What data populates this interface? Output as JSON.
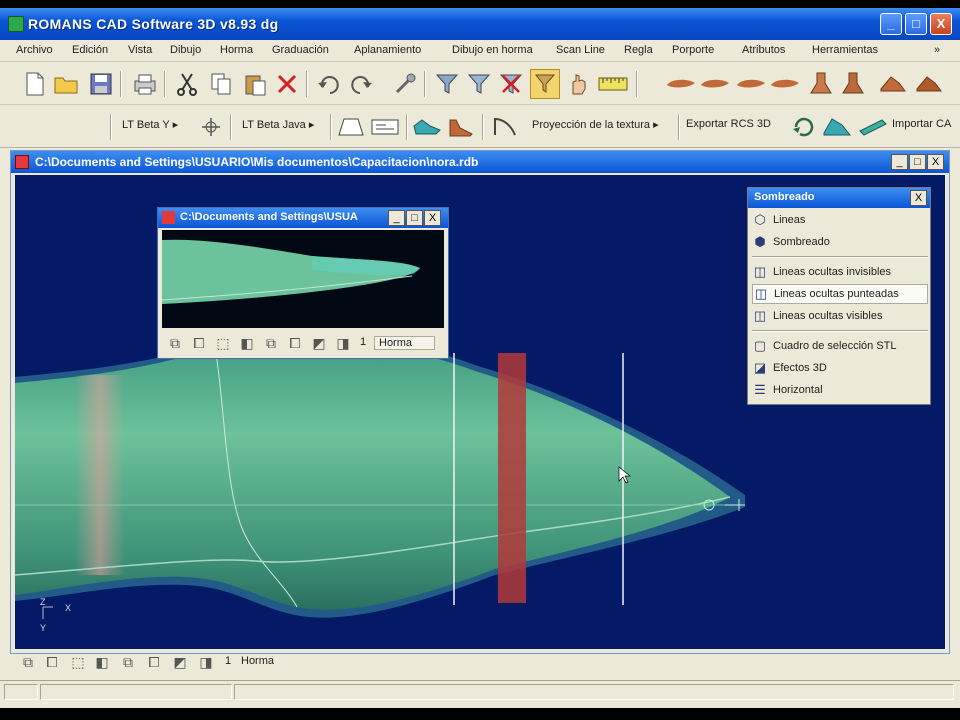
{
  "app": {
    "title": "ROMANS CAD Software 3D v8.93 dg",
    "caption_buttons": {
      "minimize": "_",
      "maximize": "□",
      "close": "X"
    }
  },
  "menu": [
    "Archivo",
    "Edición",
    "Vista",
    "Dibujo",
    "Horma",
    "Graduación",
    "Aplanamiento",
    "Dibujo en horma",
    "Scan Line",
    "Regla",
    "Porporte",
    "Atributos",
    "Herramientas"
  ],
  "menu_overflow": "»",
  "toolbar1": {
    "icons": [
      "new-file-icon",
      "open-folder-icon",
      "save-icon",
      "print-icon",
      "cut-icon",
      "copy-icon",
      "paste-icon",
      "delete-icon",
      "undo-icon",
      "redo-icon",
      "tool-icon",
      "funnel-icon",
      "funnel-2-icon",
      "funnel-delete-icon",
      "highlight-icon",
      "hand-icon",
      "ruler-icon",
      "shoe-sole-icon",
      "shoe-sole-2-icon",
      "shoe-sole-3-icon",
      "shoe-sole-4-icon",
      "boot-icon",
      "boot-2-icon",
      "shoe-3d-icon",
      "shoe-3d-2-icon"
    ]
  },
  "toolbar2": {
    "dropdown_1": "LT Beta Y",
    "dropdown_2": "LT Beta Java",
    "texture_projection": "Proyección de la textura",
    "export_label": "Exportar RCS 3D",
    "import_label": "Importar CA"
  },
  "document": {
    "title": "C:\\Documents and Settings\\USUARIO\\Mis documentos\\Capacitacion\\nora.rdb",
    "buttons": {
      "minimize": "_",
      "restore": "□",
      "close": "X"
    }
  },
  "subwindow": {
    "title": "C:\\Documents and Settings\\USUA",
    "buttons": {
      "minimize": "_",
      "restore": "□",
      "close": "X"
    },
    "toolbar_number": "1",
    "toolbar_label": "Horma"
  },
  "shading_panel": {
    "title": "Sombreado",
    "close": "X",
    "items": [
      {
        "label": "Lineas",
        "icon": "wireframe-cube-icon"
      },
      {
        "label": "Sombreado",
        "icon": "shaded-cube-icon"
      },
      {
        "label": "Lineas ocultas invisibles",
        "icon": "hidden-lines-invisible-icon"
      },
      {
        "label": "Lineas ocultas punteadas",
        "icon": "hidden-lines-dotted-icon"
      },
      {
        "label": "Lineas ocultas visibles",
        "icon": "hidden-lines-visible-icon"
      },
      {
        "label": "Cuadro de selección STL",
        "icon": "stl-selection-icon"
      },
      {
        "label": "Efectos 3D",
        "icon": "effects-3d-icon"
      },
      {
        "label": "Horizontal",
        "icon": "horizontal-icon"
      }
    ]
  },
  "axes": {
    "z": "Z",
    "x": "X",
    "y": "Y"
  },
  "bottom_toolbar": {
    "number": "1",
    "label": "Horma"
  },
  "colors": {
    "title_bar": "#0a55d6",
    "viewport_bg": "#041a66",
    "shoe_surface": "#5fb28c",
    "highlight_band": "#b33a3a"
  }
}
